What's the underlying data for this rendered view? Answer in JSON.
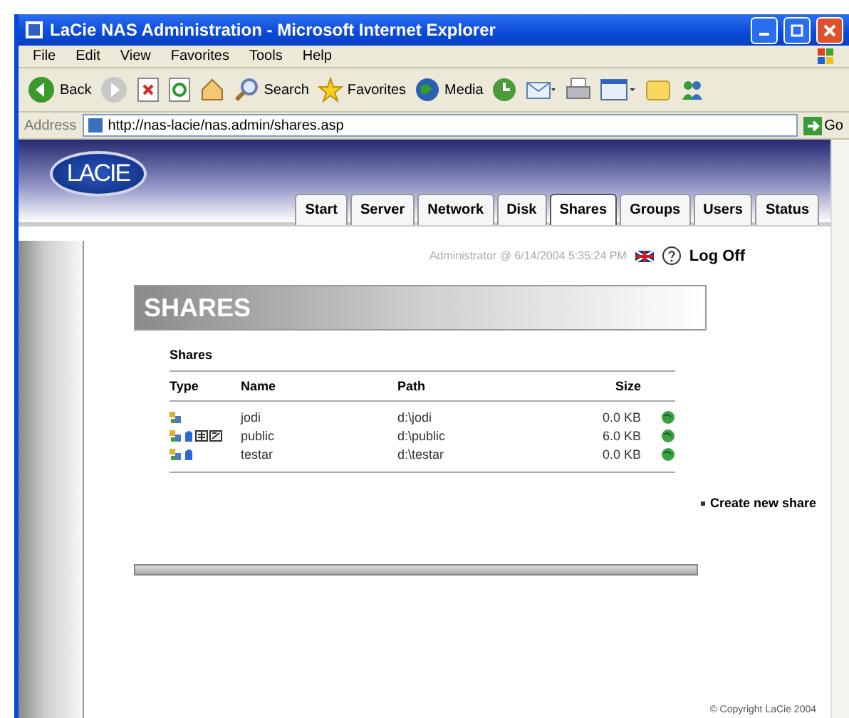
{
  "window": {
    "title": "LaCie NAS Administration - Microsoft Internet Explorer"
  },
  "menu": [
    "File",
    "Edit",
    "View",
    "Favorites",
    "Tools",
    "Help"
  ],
  "toolbar": [
    {
      "kind": "back",
      "label": "Back"
    },
    {
      "kind": "forward"
    },
    {
      "kind": "stop"
    },
    {
      "kind": "refresh"
    },
    {
      "kind": "home"
    },
    {
      "kind": "search",
      "label": "Search"
    },
    {
      "kind": "favorites",
      "label": "Favorites"
    },
    {
      "kind": "media",
      "label": "Media"
    },
    {
      "kind": "history"
    },
    {
      "kind": "mail"
    },
    {
      "kind": "print"
    },
    {
      "kind": "edit"
    },
    {
      "kind": "folder"
    },
    {
      "kind": "messenger"
    }
  ],
  "address": {
    "label": "Address",
    "value": "http://nas-lacie/nas.admin/shares.asp",
    "go": "Go"
  },
  "logo": "LACIE",
  "tabs": [
    {
      "label": "Start",
      "selected": false
    },
    {
      "label": "Server",
      "selected": false
    },
    {
      "label": "Network",
      "selected": false
    },
    {
      "label": "Disk",
      "selected": false
    },
    {
      "label": "Shares",
      "selected": true
    },
    {
      "label": "Groups",
      "selected": false
    },
    {
      "label": "Users",
      "selected": false
    },
    {
      "label": "Status",
      "selected": false
    }
  ],
  "session": {
    "user": "Administrator @ 6/14/2004 5:35:24 PM",
    "logoff": "Log Off"
  },
  "page_title": "SHARES",
  "shares": {
    "caption": "Shares",
    "columns": [
      "Type",
      "Name",
      "Path",
      "Size"
    ],
    "rows": [
      {
        "services": {
          "windows": true,
          "mac": false,
          "ftp": false,
          "http": false
        },
        "name": "jodi",
        "path": "d:\\jodi",
        "size": "0.0 KB"
      },
      {
        "services": {
          "windows": true,
          "mac": true,
          "ftp": true,
          "http": true
        },
        "name": "public",
        "path": "d:\\public",
        "size": "6.0 KB"
      },
      {
        "services": {
          "windows": true,
          "mac": true,
          "ftp": false,
          "http": false
        },
        "name": "testar",
        "path": "d:\\testar",
        "size": "0.0 KB"
      }
    ],
    "create": "Create new share"
  },
  "footer": "© Copyright LaCie 2004"
}
